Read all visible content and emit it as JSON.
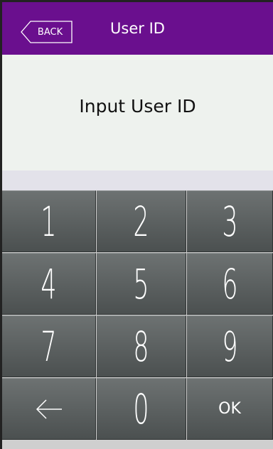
{
  "header": {
    "back_label": "BACK",
    "title": "User ID",
    "bg_color": "#6a0f8e"
  },
  "prompt": {
    "text": "Input User ID"
  },
  "keypad": {
    "keys": [
      "1",
      "2",
      "3",
      "4",
      "5",
      "6",
      "7",
      "8",
      "9",
      "0",
      "OK"
    ],
    "backspace_icon": "left-arrow-icon"
  }
}
